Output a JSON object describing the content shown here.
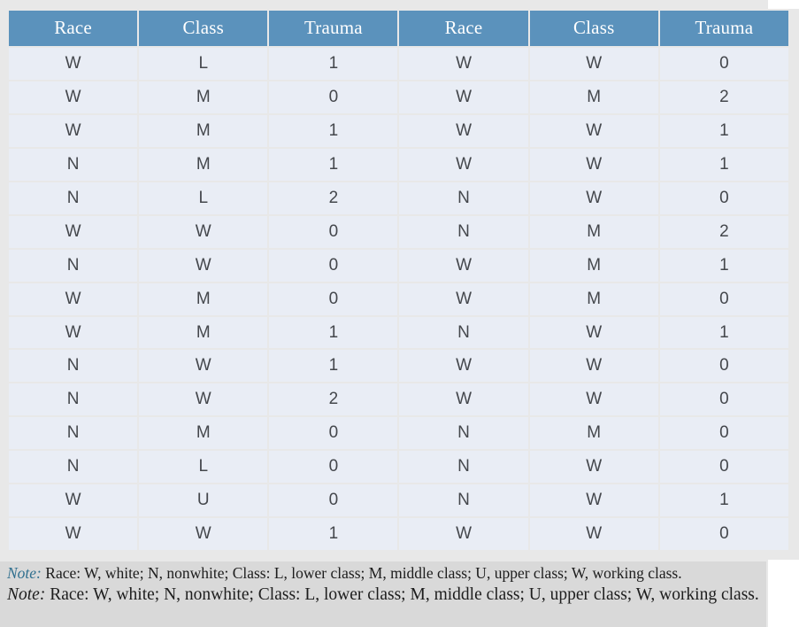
{
  "table": {
    "headers": [
      "Race",
      "Class",
      "Trauma",
      "Race",
      "Class",
      "Trauma"
    ],
    "rows": [
      [
        "W",
        "L",
        "1",
        "W",
        "W",
        "0"
      ],
      [
        "W",
        "M",
        "0",
        "W",
        "M",
        "2"
      ],
      [
        "W",
        "M",
        "1",
        "W",
        "W",
        "1"
      ],
      [
        "N",
        "M",
        "1",
        "W",
        "W",
        "1"
      ],
      [
        "N",
        "L",
        "2",
        "N",
        "W",
        "0"
      ],
      [
        "W",
        "W",
        "0",
        "N",
        "M",
        "2"
      ],
      [
        "N",
        "W",
        "0",
        "W",
        "M",
        "1"
      ],
      [
        "W",
        "M",
        "0",
        "W",
        "M",
        "0"
      ],
      [
        "W",
        "M",
        "1",
        "N",
        "W",
        "1"
      ],
      [
        "N",
        "W",
        "1",
        "W",
        "W",
        "0"
      ],
      [
        "N",
        "W",
        "2",
        "W",
        "W",
        "0"
      ],
      [
        "N",
        "M",
        "0",
        "N",
        "M",
        "0"
      ],
      [
        "N",
        "L",
        "0",
        "N",
        "W",
        "0"
      ],
      [
        "W",
        "U",
        "0",
        "N",
        "W",
        "1"
      ],
      [
        "W",
        "W",
        "1",
        "W",
        "W",
        "0"
      ]
    ]
  },
  "notes": {
    "primary": {
      "label": "Note:",
      "text": " Race: W, white; N, nonwhite; Class: L, lower class; M, middle class; U, upper class; W, working class."
    },
    "secondary": {
      "label": "Note:",
      "text": " Race: W, white; N, nonwhite; Class: L, lower class; M, middle class; U, upper class; W, working class."
    }
  },
  "colors": {
    "header_background": "#5b92bc",
    "header_text": "#ffffff",
    "cell_background": "#e9edf5",
    "cell_text": "#44474c",
    "note_band": "#d9d9d9",
    "note_accent": "#31708f",
    "page_backdrop": "#e8e8e8"
  }
}
